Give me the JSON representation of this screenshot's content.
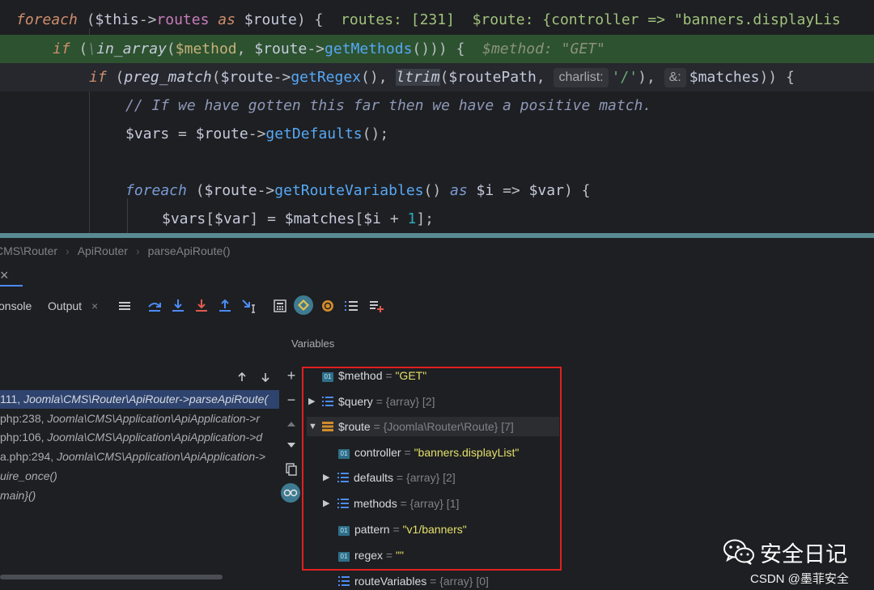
{
  "editor": {
    "lines": [
      {
        "kind": "normal"
      },
      {
        "kind": "exec"
      },
      {
        "kind": "caret"
      }
    ],
    "line0": {
      "kw": "foreach",
      "a": " (",
      "v1": "$this",
      "arrow": "->",
      "prop": "routes",
      "as": " as ",
      "v2": "$route",
      "b": ") {",
      "dbg": "  routes: [231]  $route: {controller => \"banners.displayLis"
    },
    "line1": {
      "kw": "if",
      "a": " (",
      "ns": "\\",
      "fn": "in_array",
      "b": "(",
      "v1": "$method",
      "c": ", ",
      "v2": "$route",
      "arrow": "->",
      "fn2": "getMethods",
      "d": "())) {",
      "dbg": "  $method: \"GET\""
    },
    "line2": {
      "kw": "if",
      "a": " (",
      "fn": "preg_match",
      "b": "(",
      "v1": "$route",
      "arrow": "->",
      "fn2": "getRegex",
      "c": "(), ",
      "fn3": "ltrim",
      "d": "(",
      "v2": "$routePath",
      "e": ", ",
      "hint1": "charlist:",
      "str": "'/'",
      "f": "), ",
      "hint2": "&:",
      "v3": "$matches",
      "g": ")) {"
    },
    "line3": {
      "cmt": "// If we have gotten this far then we have a positive match."
    },
    "line4": {
      "v1": "$vars",
      "a": " = ",
      "v2": "$route",
      "arrow": "->",
      "fn": "getDefaults",
      "b": "();"
    },
    "line6": {
      "kw": "foreach",
      "a": " (",
      "v1": "$route",
      "arrow": "->",
      "fn": "getRouteVariables",
      "b": "() ",
      "as": "as",
      "c": " ",
      "v2": "$i",
      "d": " => ",
      "v3": "$var",
      "e": ") {"
    },
    "line7": {
      "v1": "$vars",
      "a": "[",
      "v2": "$var",
      "b": "] = ",
      "v3": "$matches",
      "c": "[",
      "v4": "$i",
      "d": " + ",
      "num": "1",
      "e": "];"
    }
  },
  "breadcrumb": [
    "CMS\\Router",
    "ApiRouter",
    "parseApiRoute()"
  ],
  "debug": {
    "close_label": "×",
    "tabs": {
      "console": "onsole",
      "output": "Output",
      "output_close": "×"
    },
    "variables_title": "Variables",
    "frames": [
      {
        "loc": "111, ",
        "call": "Joomla\\CMS\\Router\\ApiRouter->parseApiRoute("
      },
      {
        "loc": "php:238, ",
        "call": "Joomla\\CMS\\Application\\ApiApplication->r"
      },
      {
        "loc": "php:106, ",
        "call": "Joomla\\CMS\\Application\\ApiApplication->d"
      },
      {
        "loc": "a.php:294, ",
        "call": "Joomla\\CMS\\Application\\ApiApplication->"
      },
      {
        "loc": "",
        "call": "uire_once()"
      },
      {
        "loc": "",
        "call": "main}()"
      }
    ],
    "variables": [
      {
        "name": "$method",
        "eq": " = ",
        "value": "\"GET\"",
        "meta": "",
        "icon": "string-icon",
        "expand": "none"
      },
      {
        "name": "$query",
        "eq": " = ",
        "value": "",
        "meta": "{array} [2]",
        "icon": "array-icon",
        "expand": "collapsed"
      },
      {
        "name": "$route",
        "eq": " = ",
        "value": "",
        "meta": "{Joomla\\Router\\Route} [7]",
        "icon": "object-icon",
        "expand": "expanded"
      },
      {
        "name": "controller",
        "eq": " = ",
        "value": "\"banners.displayList\"",
        "meta": "",
        "icon": "string-icon",
        "expand": "none"
      },
      {
        "name": "defaults",
        "eq": " = ",
        "value": "",
        "meta": "{array} [2]",
        "icon": "array-icon",
        "expand": "collapsed"
      },
      {
        "name": "methods",
        "eq": " = ",
        "value": "",
        "meta": "{array} [1]",
        "icon": "array-icon",
        "expand": "collapsed"
      },
      {
        "name": "pattern",
        "eq": " = ",
        "value": "\"v1/banners\"",
        "meta": "",
        "icon": "string-icon",
        "expand": "none"
      },
      {
        "name": "regex",
        "eq": " = ",
        "value": "\"\"",
        "meta": "",
        "icon": "string-icon",
        "expand": "none"
      },
      {
        "name": "routeVariables",
        "eq": " = ",
        "value": "",
        "meta": "{array} [0]",
        "icon": "array-icon",
        "expand": "none"
      }
    ]
  },
  "watermark": {
    "title": "安全日记",
    "subtitle": "CSDN @墨菲安全"
  },
  "colors": {
    "exec_line": "#2d5230",
    "highlight_box": "#e02020",
    "selected_frame": "#2e436e",
    "accent": "#4c8bf5"
  }
}
